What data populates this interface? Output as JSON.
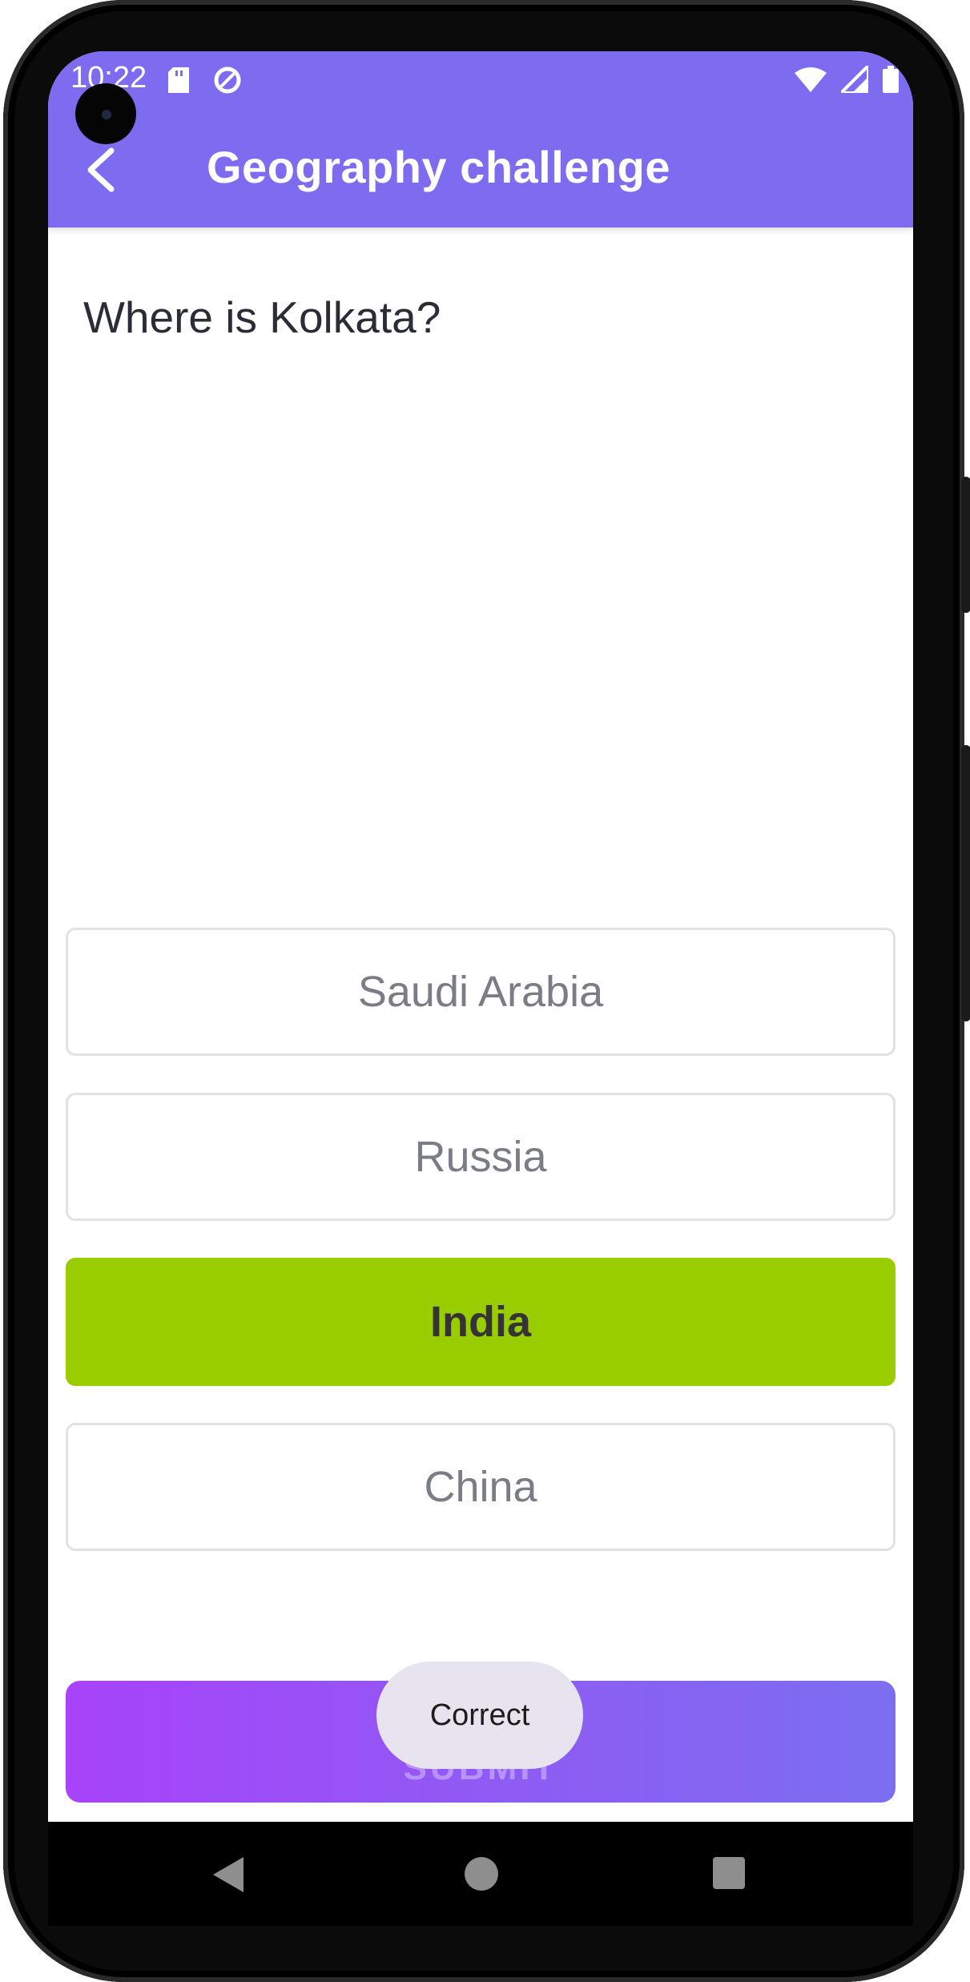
{
  "status_bar": {
    "time": "10:22",
    "icons_left": [
      "sd-card-icon",
      "data-saver-icon"
    ],
    "icons_right": [
      "wifi-icon",
      "signal-icon",
      "battery-icon"
    ]
  },
  "app_bar": {
    "title": "Geography challenge",
    "back_icon": "back-arrow-icon",
    "color": "#7d6cf0"
  },
  "question": {
    "text": "Where is Kolkata?"
  },
  "options": [
    {
      "label": "Saudi Arabia",
      "selected": false
    },
    {
      "label": "Russia",
      "selected": false
    },
    {
      "label": "India",
      "selected": true
    },
    {
      "label": "China",
      "selected": false
    }
  ],
  "colors": {
    "selected_option": "#9acd00",
    "submit_gradient_start": "#a843fb",
    "submit_gradient_end": "#7c6ef1"
  },
  "submit": {
    "label": "SUBMIT"
  },
  "toast": {
    "text": "Correct"
  },
  "nav_bar": {
    "icons": [
      "nav-back-icon",
      "nav-home-icon",
      "nav-recents-icon"
    ]
  }
}
